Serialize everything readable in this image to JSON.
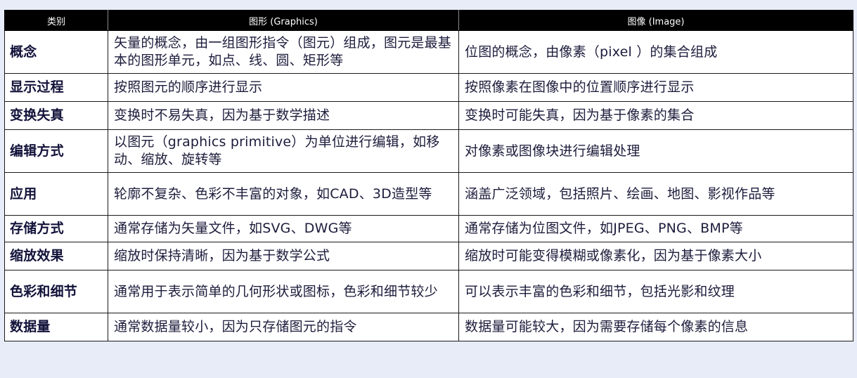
{
  "header": {
    "col1": "类别",
    "col2": "图形 (Graphics)",
    "col3": "图像 (Image)"
  },
  "rows": [
    {
      "category": "概念",
      "graphics": "矢量的概念，由一组图形指令（图元）组成，图元是最基本的图形单元，如点、线、圆、矩形等",
      "image": "位图的概念，由像素（pixel ）的集合组成"
    },
    {
      "category": "显示过程",
      "graphics": "按照图元的顺序进行显示",
      "image": "按照像素在图像中的位置顺序进行显示"
    },
    {
      "category": "变换失真",
      "graphics": "变换时不易失真，因为基于数学描述",
      "image": "变换时可能失真，因为基于像素的集合"
    },
    {
      "category": "编辑方式",
      "graphics": "以图元（graphics primitive）为单位进行编辑，如移动、缩放、旋转等",
      "image": "对像素或图像块进行编辑处理"
    },
    {
      "category": "应用",
      "graphics": "轮廓不复杂、色彩不丰富的对象，如CAD、3D造型等",
      "image": "涵盖广泛领域，包括照片、绘画、地图、影视作品等"
    },
    {
      "category": "存储方式",
      "graphics": "通常存储为矢量文件，如SVG、DWG等",
      "image": "通常存储为位图文件，如JPEG、PNG、BMP等"
    },
    {
      "category": "缩放效果",
      "graphics": "缩放时保持清晰，因为基于数学公式",
      "image": "缩放时可能变得模糊或像素化，因为基于像素大小"
    },
    {
      "category": "色彩和细节",
      "graphics": "通常用于表示简单的几何形状或图标，色彩和细节较少",
      "image": "可以表示丰富的色彩和细节，包括光影和纹理"
    },
    {
      "category": "数据量",
      "graphics": "通常数据量较小，因为只存储图元的指令",
      "image": "数据量可能较大，因为需要存储每个像素的信息"
    }
  ]
}
